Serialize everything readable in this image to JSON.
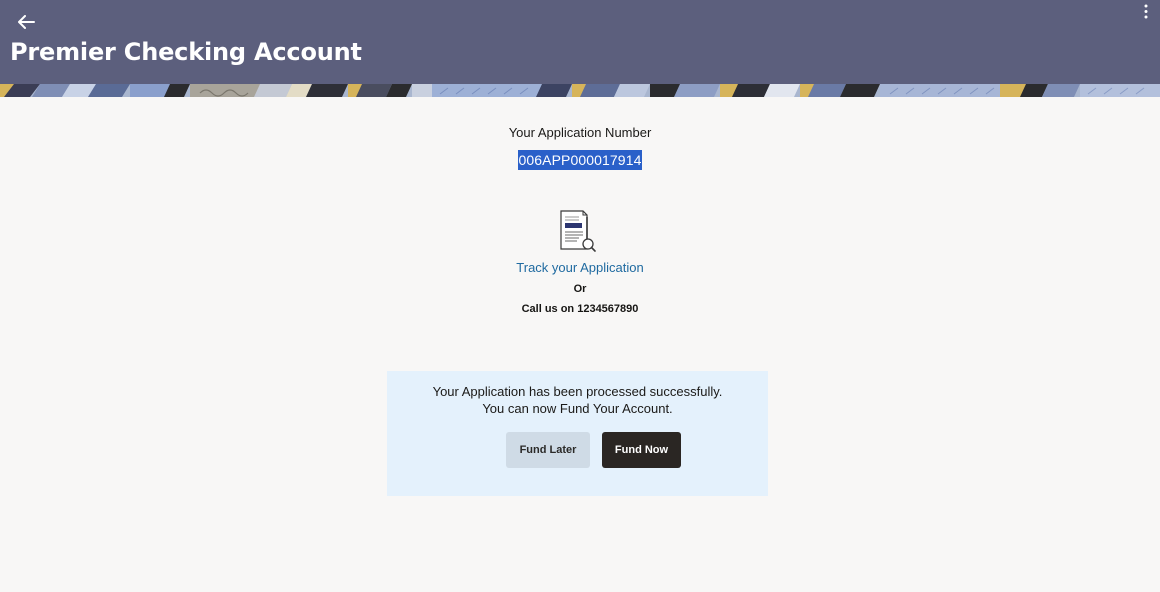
{
  "header": {
    "title": "Premier Checking Account",
    "back_icon": "back-arrow-icon",
    "menu_icon": "kebab-menu-icon",
    "background_color": "#5c5f7d"
  },
  "application": {
    "number_label": "Your Application Number",
    "number": "006APP000017914",
    "track_icon": "document-search-icon",
    "track_link": "Track your Application",
    "or_text": "Or",
    "call_text": "Call us on 1234567890"
  },
  "fund_panel": {
    "message_line1": "Your Application has been processed successfully.",
    "message_line2": "You can now Fund Your Account.",
    "fund_later_label": "Fund Later",
    "fund_now_label": "Fund Now",
    "background_color": "#e4f1fc"
  },
  "colors": {
    "selection_highlight": "#2a60c9",
    "link": "#1f6aa0",
    "primary_button": "#2a2623",
    "secondary_button": "#cfdbe6"
  }
}
